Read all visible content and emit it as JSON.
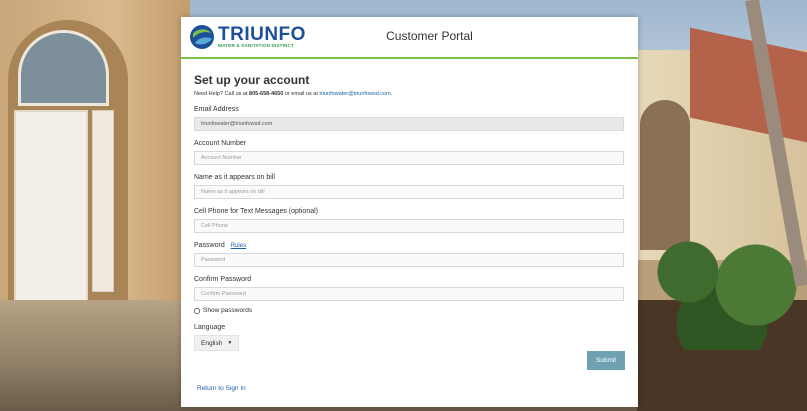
{
  "header": {
    "logo_name": "TRIUNFO",
    "logo_subtitle": "WATER & SANITATION DISTRICT",
    "portal_title": "Customer Portal"
  },
  "form": {
    "heading": "Set up your account",
    "help_prefix": "Need Help? Call us at",
    "help_phone": "805-658-4650",
    "help_middle": "or email us at",
    "help_email": "triunfowater@triunfowsd.com",
    "help_suffix": ".",
    "email": {
      "label": "Email Address",
      "value": "triunfowater@triunfowsd.com"
    },
    "account": {
      "label": "Account Number",
      "placeholder": "Account Number"
    },
    "name_on_bill": {
      "label": "Name as it appears on bill",
      "placeholder": "Name as it appears on bill"
    },
    "cell_phone": {
      "label": "Cell Phone for Text Messages (optional)",
      "placeholder": "Cell Phone"
    },
    "password": {
      "label": "Password",
      "rules_link": "Rules",
      "placeholder": "Password"
    },
    "confirm_password": {
      "label": "Confirm Password",
      "placeholder": "Confirm Password"
    },
    "show_passwords": "Show passwords",
    "language": {
      "label": "Language",
      "selected": "English"
    },
    "submit": "Submit",
    "return_link": "Return to Sign In"
  },
  "colors": {
    "accent_green": "#7cc24a",
    "brand_blue": "#1d4f9a",
    "link_blue": "#1f5fa8",
    "submit_bg": "#6fa1b3"
  }
}
